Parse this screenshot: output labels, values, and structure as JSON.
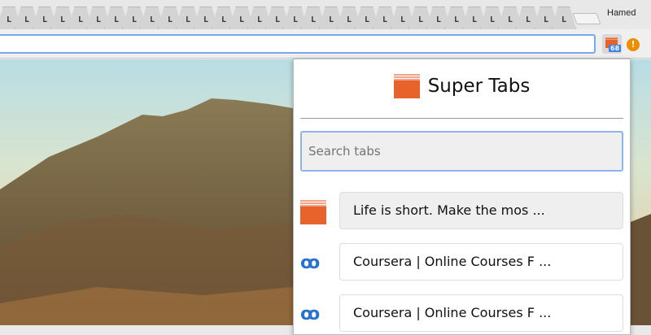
{
  "browser": {
    "tab_favicon_letter": "L",
    "tab_count": 32,
    "user_name": "Hamed",
    "omnibox_value": "",
    "extension_badge": "68",
    "warning_icon_glyph": "!"
  },
  "popup": {
    "title": "Super Tabs",
    "search_placeholder": "Search tabs",
    "items": [
      {
        "title": "Life is short. Make the mos ...",
        "icon": "super-tabs-icon",
        "active": true
      },
      {
        "title": "Coursera | Online Courses F ...",
        "icon": "coursera-icon",
        "active": false
      },
      {
        "title": "Coursera | Online Courses F ...",
        "icon": "coursera-icon",
        "active": false
      }
    ]
  },
  "colors": {
    "accent": "#e8622c",
    "focus": "#8fb3ec",
    "coursera": "#2a73cc",
    "badge": "#3b82e6"
  }
}
